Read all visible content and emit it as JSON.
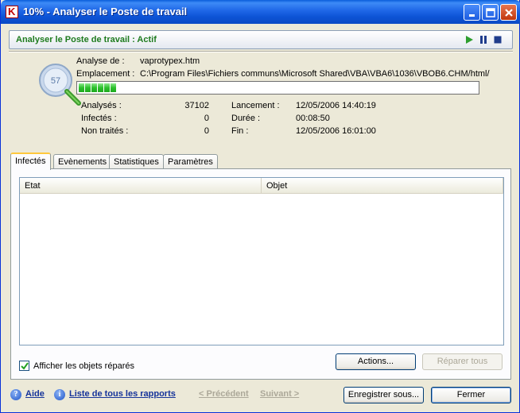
{
  "window": {
    "title": "10% - Analyser le Poste de travail",
    "icon": "kaspersky-k-icon"
  },
  "status": {
    "title": "Analyser le Poste de travail : Actif",
    "accent": "#1E7B1E",
    "controls": [
      "play-icon",
      "pause-icon",
      "stop-icon"
    ]
  },
  "scan": {
    "icon_number": "57",
    "object_label": "Analyse de :",
    "object_value": "vaprotypex.htm",
    "location_label": "Emplacement :",
    "location_value": "C:\\Program Files\\Fichiers communs\\Microsoft Shared\\VBA\\VBA6\\1036\\VBOB6.CHM/html/",
    "progress_percent": 10
  },
  "stats": {
    "analyzed_label": "Analysés :",
    "analyzed_value": "37102",
    "infected_label": "Infectés :",
    "infected_value": "0",
    "untreated_label": "Non traités :",
    "untreated_value": "0",
    "start_label": "Lancement :",
    "start_value": "12/05/2006 14:40:19",
    "duration_label": "Durée :",
    "duration_value": "00:08:50",
    "end_label": "Fin :",
    "end_value": "12/05/2006 16:01:00"
  },
  "tabs": [
    {
      "label": "Infectés",
      "active": true
    },
    {
      "label": "Evènements",
      "active": false
    },
    {
      "label": "Statistiques",
      "active": false
    },
    {
      "label": "Paramètres",
      "active": false
    }
  ],
  "table": {
    "columns": [
      "Etat",
      "Objet"
    ],
    "rows": []
  },
  "options": {
    "show_repaired_label": "Afficher les objets réparés",
    "show_repaired_checked": true
  },
  "buttons": {
    "actions": "Actions...",
    "repair_all": "Réparer tous",
    "save": "Enregistrer sous...",
    "close": "Fermer"
  },
  "footer": {
    "help": "Aide",
    "reports": "Liste de tous les rapports",
    "previous": "< Précédent",
    "next": "Suivant >"
  }
}
